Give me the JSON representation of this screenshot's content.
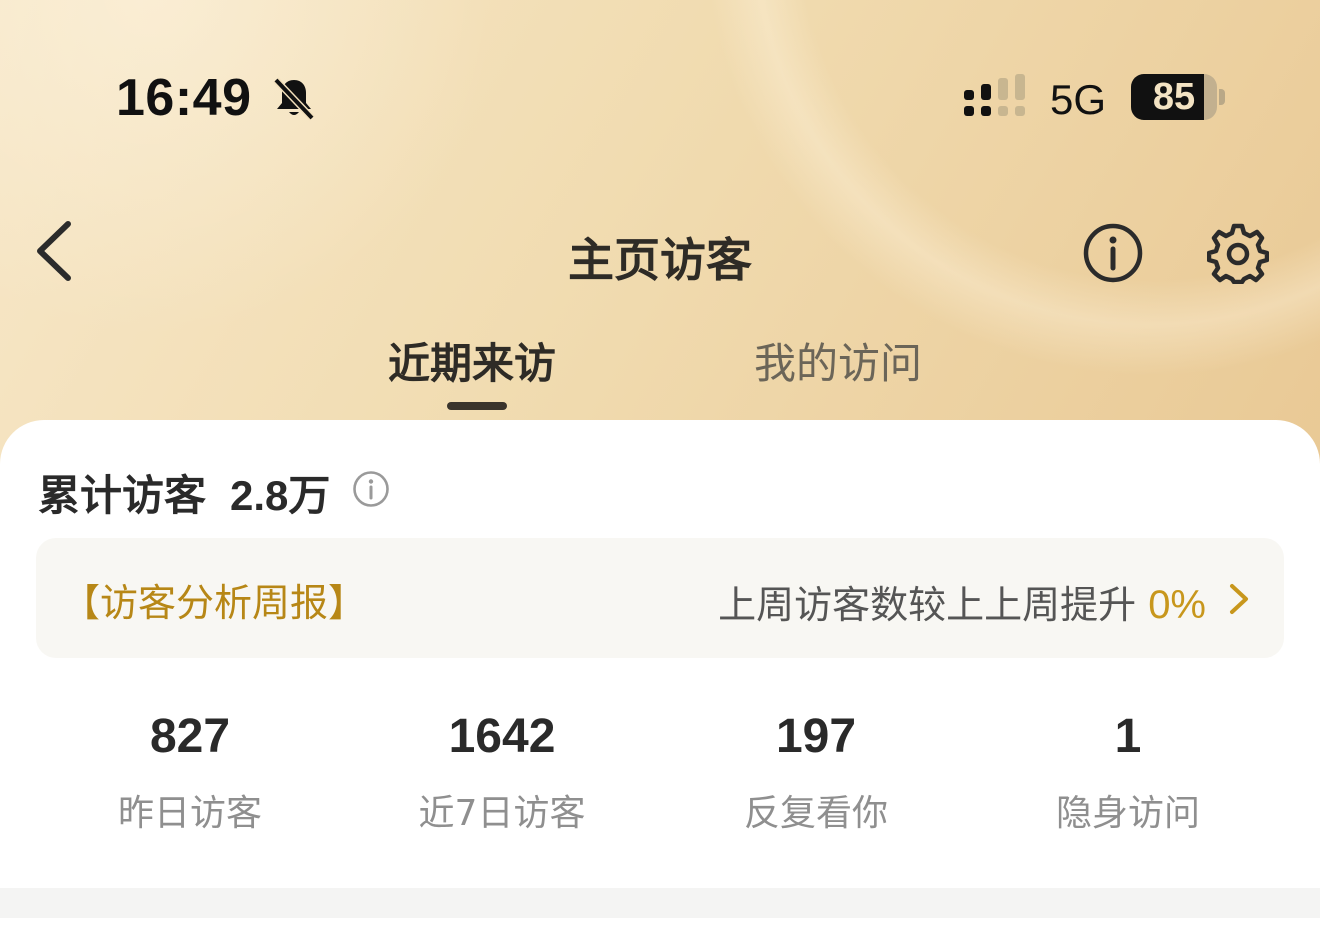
{
  "status_bar": {
    "time": "16:49",
    "network": "5G",
    "battery_level": "85",
    "battery_fraction": 0.85
  },
  "header": {
    "title": "主页访客"
  },
  "tabs": [
    {
      "label": "近期来访",
      "active": true
    },
    {
      "label": "我的访问",
      "active": false
    }
  ],
  "summary": {
    "total_label": "累计访客",
    "total_value": "2.8万"
  },
  "weekly_report": {
    "title": "【访客分析周报】",
    "description": "上周访客数较上上周提升",
    "percent": "0%"
  },
  "stats": [
    {
      "value": "827",
      "label": "昨日访客"
    },
    {
      "value": "1642",
      "label": "近7日访客"
    },
    {
      "value": "197",
      "label": "反复看你"
    },
    {
      "value": "1",
      "label": "隐身访问"
    }
  ],
  "colors": {
    "accent_gold": "#b78716",
    "percent_gold": "#c8971c",
    "hero_gradient_start": "#f7e7c8",
    "hero_gradient_end": "#e9c995"
  },
  "icons": [
    "bell-off-icon",
    "signal-icon",
    "battery-icon",
    "back-icon",
    "info-icon",
    "gear-icon",
    "chevron-right-icon"
  ]
}
